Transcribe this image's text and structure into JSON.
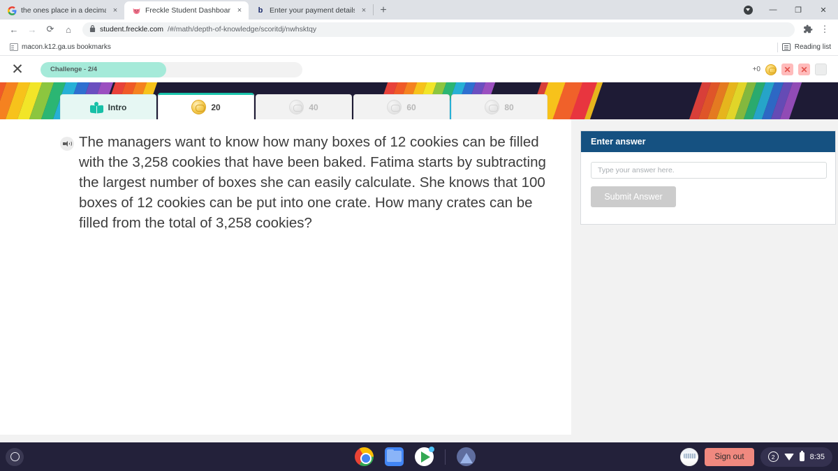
{
  "browser": {
    "tabs": [
      {
        "title": "the ones place in a decimal - Goo",
        "favicon": "google-icon",
        "active": false
      },
      {
        "title": "Freckle Student Dashboard",
        "favicon": "freckle-pig-icon",
        "active": true
      },
      {
        "title": "Enter your payment details | ban",
        "favicon": "b-icon",
        "active": false
      }
    ],
    "new_tab_label": "+",
    "close_label": "×",
    "window_controls": {
      "minimize": "—",
      "maximize": "❐",
      "close": "✕"
    },
    "nav": {
      "back": "←",
      "forward": "→",
      "reload": "⟳",
      "home": "⌂"
    },
    "url": {
      "lock": "🔒",
      "domain": "student.freckle.com",
      "path": "/#/math/depth-of-knowledge/scoritdj/nwhsktqy"
    },
    "toolbar": {
      "extensions": "🧩",
      "menu": "⋮"
    },
    "bookmarks": {
      "items": [
        {
          "label": "macon.k12.ga.us bookmarks"
        }
      ],
      "reading_list": "Reading list"
    }
  },
  "app_header": {
    "close_label": "✕",
    "progress_label": "Challenge - 2/4",
    "progress_percent": 48,
    "coin_count": "+0",
    "lives": [
      {
        "state": "used",
        "glyph": "✕"
      },
      {
        "state": "used",
        "glyph": "✕"
      },
      {
        "state": "empty",
        "glyph": ""
      }
    ]
  },
  "level_tabs": [
    {
      "label": "Intro",
      "icon": "book-icon",
      "state": "completed"
    },
    {
      "label": "20",
      "icon": "coin-icon",
      "state": "active"
    },
    {
      "label": "40",
      "icon": "coin-icon",
      "state": "locked"
    },
    {
      "label": "60",
      "icon": "coin-icon",
      "state": "locked"
    },
    {
      "label": "80",
      "icon": "coin-icon",
      "state": "locked"
    }
  ],
  "question": {
    "audio_icon": "speaker-icon",
    "text": "The managers want to know how many boxes of 12 cookies can be filled with the 3,258 cookies that have been baked. Fatima starts by subtracting the largest number of boxes she can easily calculate. She knows that 100 boxes of 12 cookies can be put into one crate. How many crates can be filled from the total of 3,258 cookies?"
  },
  "answer_panel": {
    "header": "Enter answer",
    "input_value": "",
    "input_placeholder": "Type your answer here.",
    "submit_label": "Submit Answer"
  },
  "shelf": {
    "launcher": "launcher-icon",
    "apps": [
      {
        "name": "chrome-icon"
      },
      {
        "name": "files-icon"
      },
      {
        "name": "play-store-icon"
      },
      {
        "name": "gallery-icon"
      }
    ],
    "sign_out_label": "Sign out",
    "tray": {
      "badge": "2",
      "wifi": "wifi-icon",
      "battery": "battery-icon",
      "time": "8:35"
    }
  },
  "colors": {
    "accent_teal": "#19c3aa",
    "progress_fill": "#a5ead9",
    "answer_header": "#155181",
    "shelf_bg": "#23213a",
    "signout": "#f0897f",
    "band_bg": "#1e1b35"
  }
}
